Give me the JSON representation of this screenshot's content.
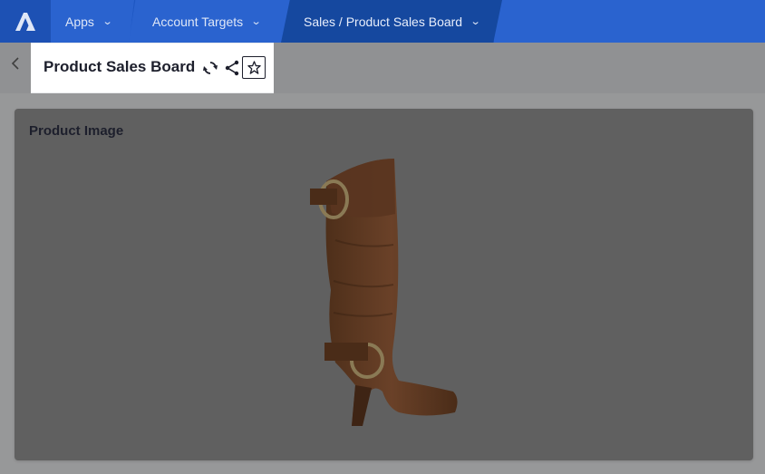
{
  "nav": {
    "logo_icon": "app-logo-icon",
    "apps_label": "Apps",
    "targets_label": "Account Targets",
    "current_label": "Sales / Product Sales Board",
    "chevron_icon": "chevron-down-icon"
  },
  "header": {
    "back_icon": "chevron-left-icon",
    "title": "Product Sales Board",
    "refresh_icon": "refresh-icon",
    "share_icon": "share-icon",
    "favorite_icon": "star-icon"
  },
  "card": {
    "title": "Product Image",
    "image_subject": "brown-knee-high-boot"
  },
  "colors": {
    "nav_bg": "#1e57c2",
    "title_text": "#1d1f2c",
    "boot_brown": "#7a4a2b"
  }
}
